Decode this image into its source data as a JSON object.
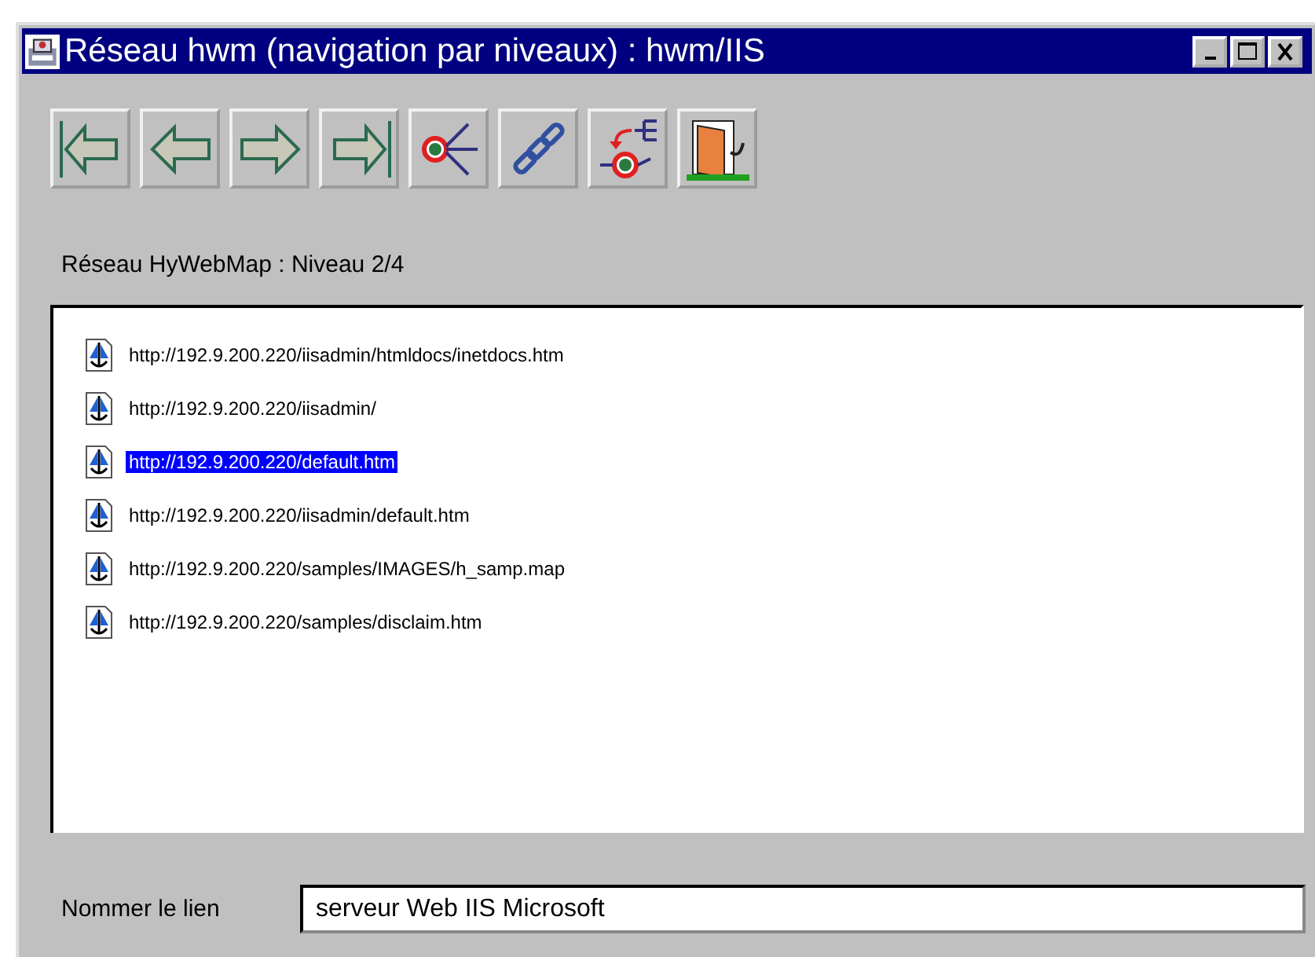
{
  "window": {
    "title": "Réseau hwm (navigation par niveaux) : hwm/IIS"
  },
  "toolbar": [
    {
      "kind": "first"
    },
    {
      "kind": "back"
    },
    {
      "kind": "forward"
    },
    {
      "kind": "last"
    },
    {
      "kind": "links"
    },
    {
      "kind": "chain"
    },
    {
      "kind": "tree"
    },
    {
      "kind": "exit"
    }
  ],
  "level_label": "Réseau HyWebMap : Niveau 2/4",
  "links": [
    {
      "url": "http://192.9.200.220/iisadmin/htmldocs/inetdocs.htm",
      "selected": false
    },
    {
      "url": "http://192.9.200.220/iisadmin/",
      "selected": false
    },
    {
      "url": "http://192.9.200.220/default.htm",
      "selected": true
    },
    {
      "url": "http://192.9.200.220/iisadmin/default.htm",
      "selected": false
    },
    {
      "url": "http://192.9.200.220/samples/IMAGES/h_samp.map",
      "selected": false
    },
    {
      "url": "http://192.9.200.220/samples/disclaim.htm",
      "selected": false
    }
  ],
  "name_field": {
    "label": "Nommer le lien",
    "value": "serveur Web IIS Microsoft"
  }
}
